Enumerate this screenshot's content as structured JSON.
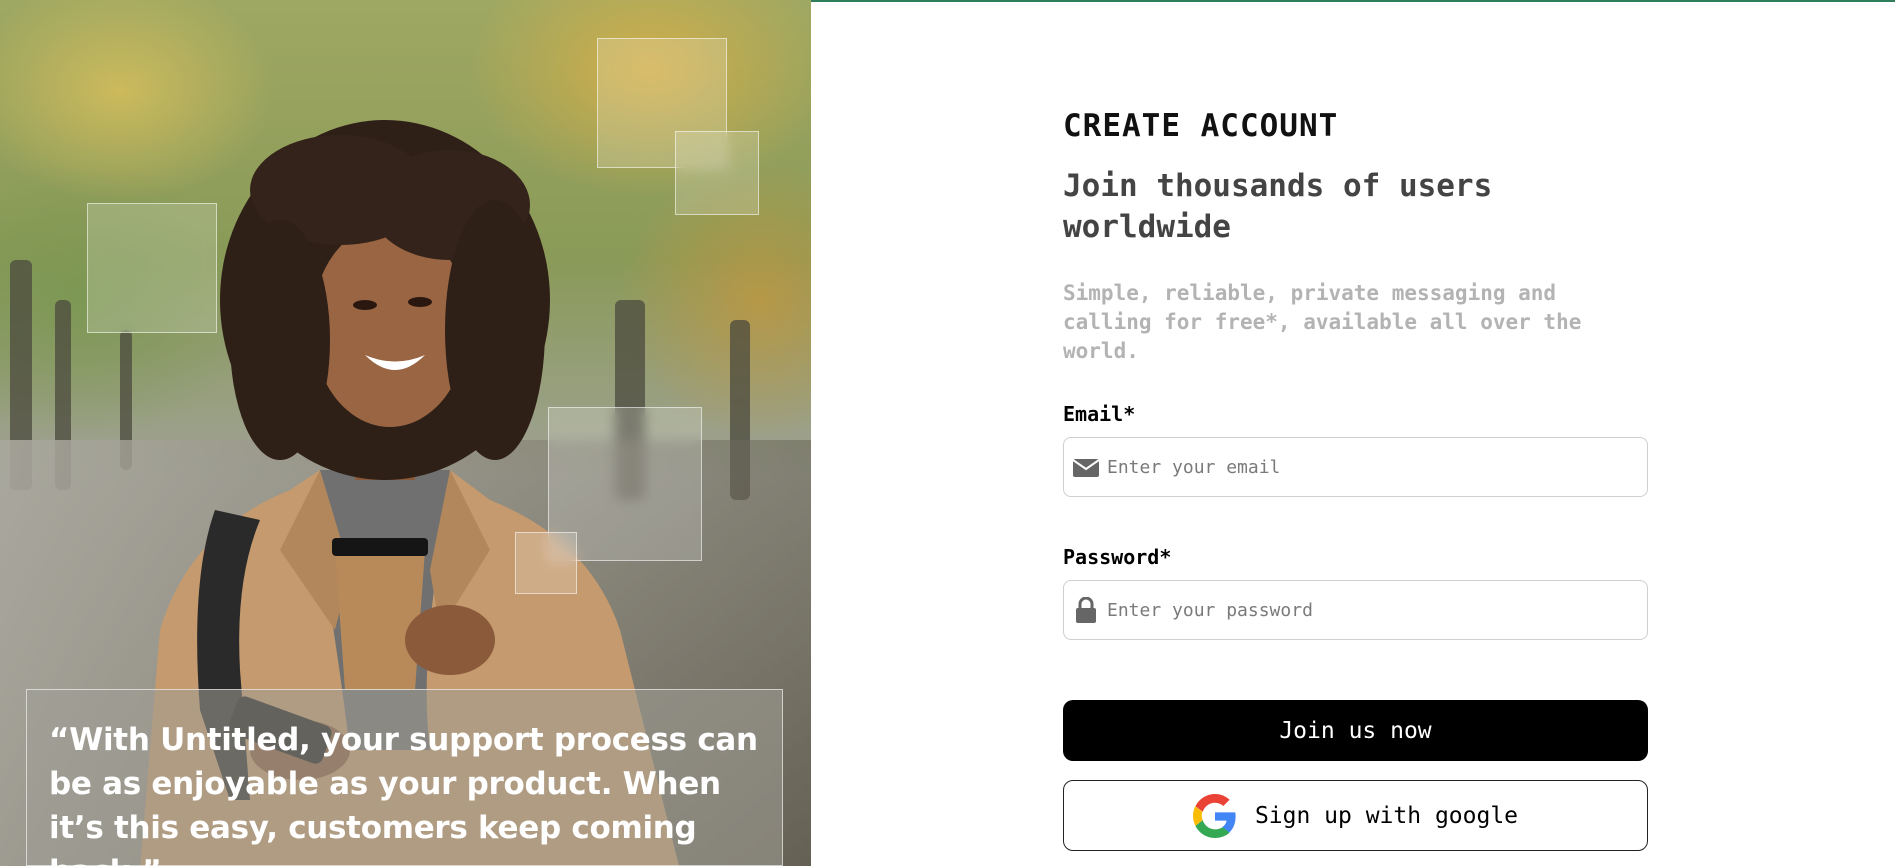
{
  "hero": {
    "image": "woman-with-coffee-photo",
    "quote": "“With Untitled, your support process can be as enjoyable as your product. When it’s this easy, customers keep coming back.”"
  },
  "form": {
    "eyebrow": "CREATE ACCOUNT",
    "headline": "Join thousands of users worldwide",
    "subtext": "Simple, reliable, private messaging and calling for free*, available all over the world.",
    "email": {
      "label": "Email*",
      "placeholder": "Enter your email",
      "value": "",
      "icon": "envelope-icon"
    },
    "password": {
      "label": "Password*",
      "placeholder": "Enter your password",
      "value": "",
      "icon": "lock-icon"
    },
    "submit_label": "Join us now",
    "google_label": "Sign up with google"
  },
  "colors": {
    "primary_button": "#000000",
    "top_accent": "#2e7d5b",
    "google_blue": "#4285F4",
    "google_red": "#EA4335",
    "google_yellow": "#FBBC05",
    "google_green": "#34A853"
  }
}
